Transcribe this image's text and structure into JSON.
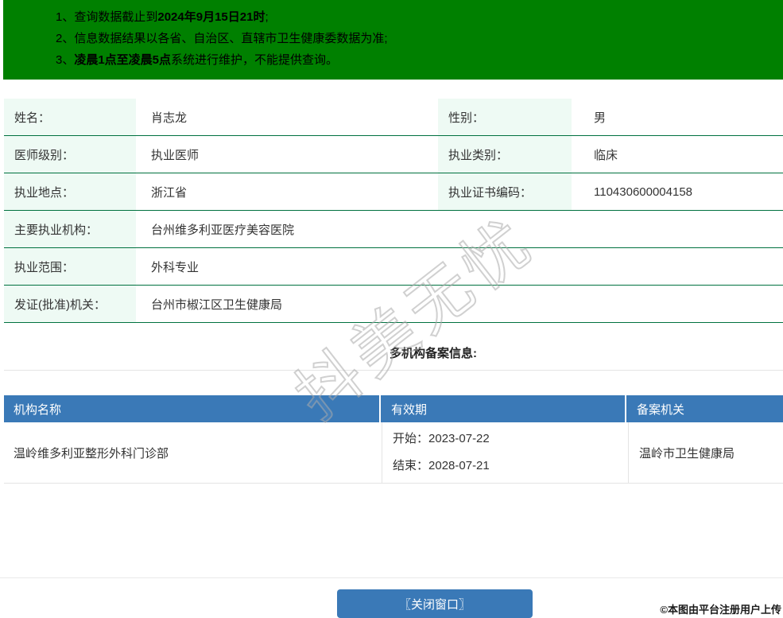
{
  "colors": {
    "banner_green": "#008000",
    "separator_green": "#00713f",
    "label_cell_bg": "#eefaf4",
    "table_header_blue": "#3a79b7",
    "button_blue": "#3a79b7"
  },
  "notice": {
    "line1": {
      "num": "1、",
      "seg_a": "查询数据截止到",
      "seg_b": "2024年9月15日21时",
      "seg_c": ";"
    },
    "line2": {
      "num": "2、",
      "seg_a": "信息数据结果以各省、自治区、直辖市卫生健康委数据为准;",
      "seg_b": "",
      "seg_c": ""
    },
    "line3": {
      "num": "3、",
      "seg_a": "",
      "seg_b": "凌晨1点至凌晨5点",
      "seg_c": "系统进行维护，不能提供查询。"
    }
  },
  "profile": {
    "rows": [
      {
        "label1": "姓名：",
        "value1": "肖志龙",
        "label2": "性别：",
        "value2": "男"
      },
      {
        "label1": "医师级别：",
        "value1": "执业医师",
        "label2": "执业类别：",
        "value2": "临床"
      },
      {
        "label1": "执业地点：",
        "value1": "浙江省",
        "label2": "执业证书编码：",
        "value2": "110430600004158"
      },
      {
        "label1": "主要执业机构：",
        "value1": "台州维多利亚医疗美容医院"
      },
      {
        "label1": "执业范围：",
        "value1": "外科专业"
      },
      {
        "label1": "发证(批准)机关：",
        "value1": "台州市椒江区卫生健康局"
      }
    ]
  },
  "records": {
    "title": "多机构备案信息:",
    "headers": [
      "机构名称",
      "有效期",
      "备案机关"
    ],
    "rows": [
      {
        "org": "温岭维多利亚整形外科门诊部",
        "start_label": "开始：",
        "start_date": "2023-07-22",
        "end_label": "结束：",
        "end_date": "2028-07-21",
        "authority": "温岭市卫生健康局"
      }
    ]
  },
  "watermark": {
    "diagonal": "抖美无忧",
    "credit": "©本图由平台注册用户上传"
  },
  "footer": {
    "close_label": "〖关闭窗口〗"
  }
}
